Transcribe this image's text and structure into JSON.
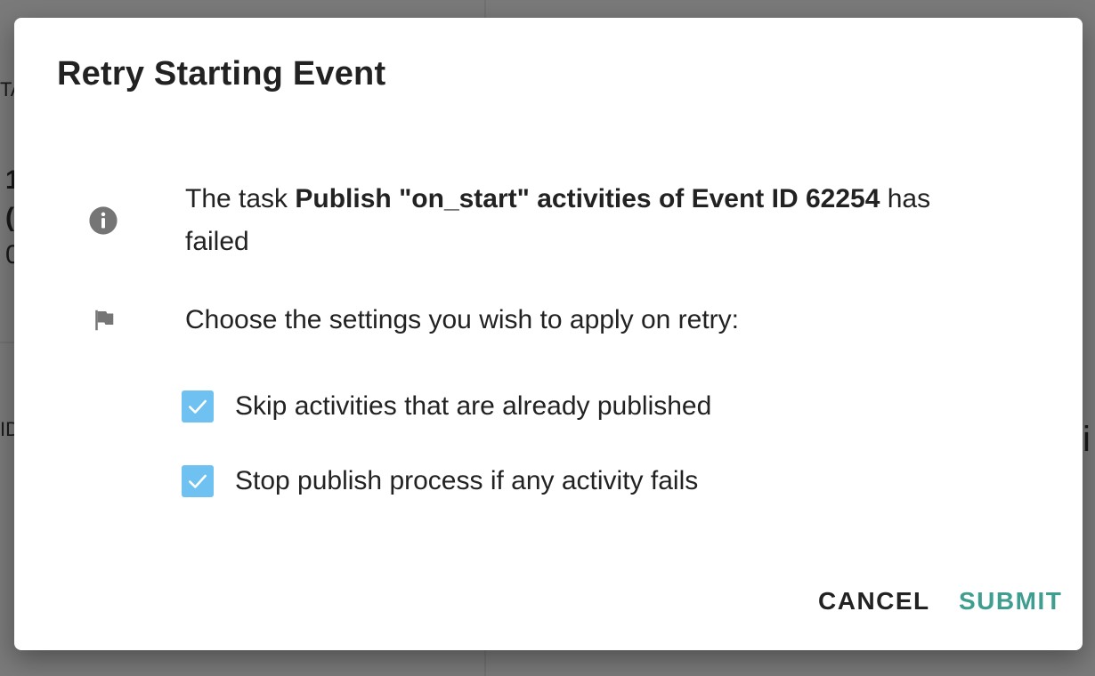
{
  "background": {
    "fragments": [
      "TA",
      "1",
      "(",
      "0",
      "ID",
      "i"
    ]
  },
  "dialog": {
    "title": "Retry Starting Event",
    "info": {
      "prefix": "The task ",
      "task_name": "Publish \"on_start\" activities of Event ID 62254",
      "suffix": " has failed"
    },
    "choose_text": "Choose the settings you wish to apply on retry:",
    "options": [
      {
        "label": "Skip activities that are already published",
        "checked": true
      },
      {
        "label": "Stop publish process if any activity fails",
        "checked": true
      }
    ],
    "cancel_label": "CANCEL",
    "submit_label": "SUBMIT"
  },
  "colors": {
    "checkbox": "#6ec1f0",
    "submit": "#3f9e8f",
    "icon": "#757575"
  }
}
